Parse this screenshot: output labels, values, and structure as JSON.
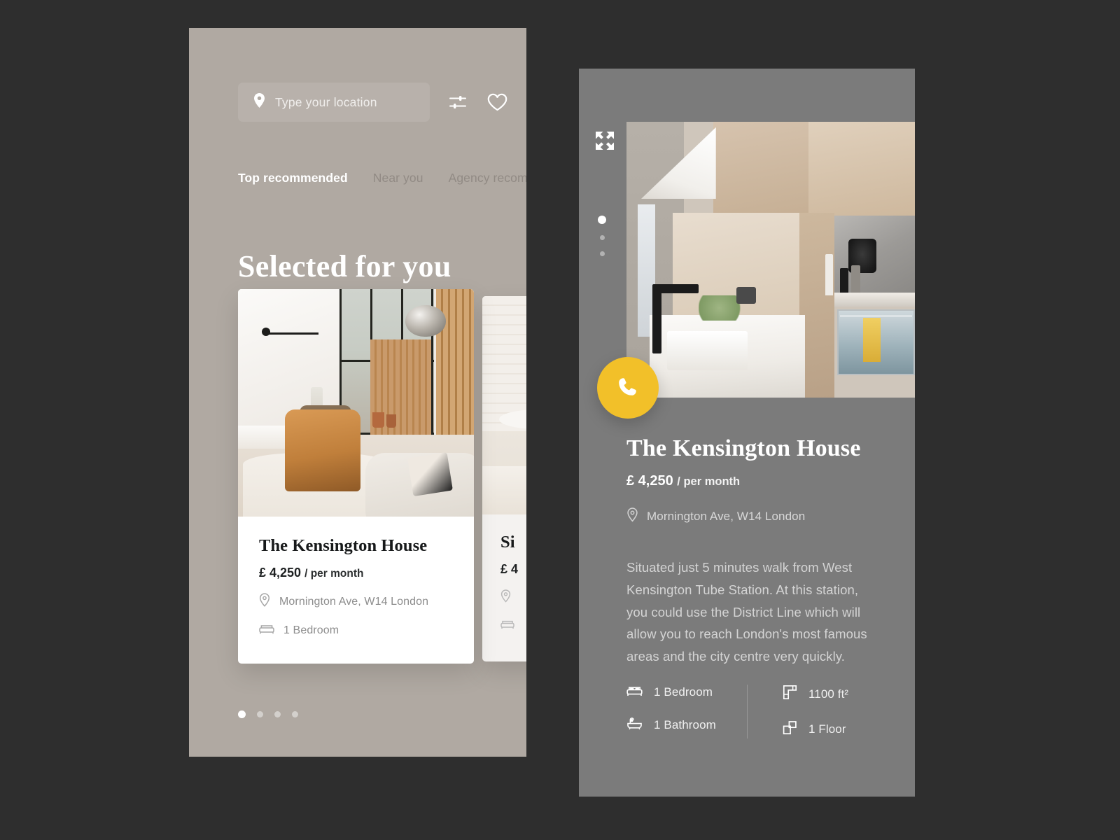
{
  "colors": {
    "page_background": "#2e2e2e",
    "phone_listing_background": "#b0a9a2",
    "phone_detail_background": "#7b7b7b",
    "accent_call_button": "#f2c029",
    "card_surface": "#ffffff"
  },
  "listing_screen": {
    "search": {
      "placeholder": "Type your location",
      "value": "",
      "pin_icon": "location-pin-icon",
      "filter_icon": "filter-sliders-icon",
      "favorites_icon": "heart-icon"
    },
    "tabs": [
      {
        "label": "Top recommended",
        "active": true
      },
      {
        "label": "Near you",
        "active": false
      },
      {
        "label": "Agency recommended",
        "active": false
      }
    ],
    "section_title": "Selected for you",
    "cards": [
      {
        "title": "The Kensington House",
        "price": "£ 4,250",
        "price_period": "/ per month",
        "address": "Mornington Ave, W14 London",
        "bedrooms": "1 Bedroom",
        "address_icon": "location-pin-icon",
        "bed_icon": "bed-icon"
      },
      {
        "title": "Si",
        "price": "£ 4",
        "price_period": "",
        "address": "",
        "bedrooms": "",
        "address_icon": "location-pin-icon",
        "bed_icon": "bed-icon"
      }
    ],
    "pagination": {
      "total": 4,
      "active_index": 0
    }
  },
  "detail_screen": {
    "expand_icon": "fullscreen-expand-icon",
    "gallery_pagination": {
      "total": 3,
      "active_index": 0
    },
    "call_button": {
      "icon": "phone-call-icon",
      "label": ""
    },
    "title": "The Kensington House",
    "price": "£ 4,250",
    "price_period": "/ per month",
    "address": "Mornington Ave, W14 London",
    "address_icon": "location-pin-icon",
    "description": "Situated just 5 minutes walk from West Kensington Tube Station. At this station, you could use the District Line which will allow you to reach London's most famous areas and the city centre very quickly.",
    "specs": [
      {
        "label": "1 Bedroom",
        "icon": "bed-icon"
      },
      {
        "label": "1 Bathroom",
        "icon": "bathtub-icon"
      },
      {
        "label": "1100 ft²",
        "icon": "floor-area-icon"
      },
      {
        "label": "1 Floor",
        "icon": "floors-icon"
      }
    ]
  }
}
